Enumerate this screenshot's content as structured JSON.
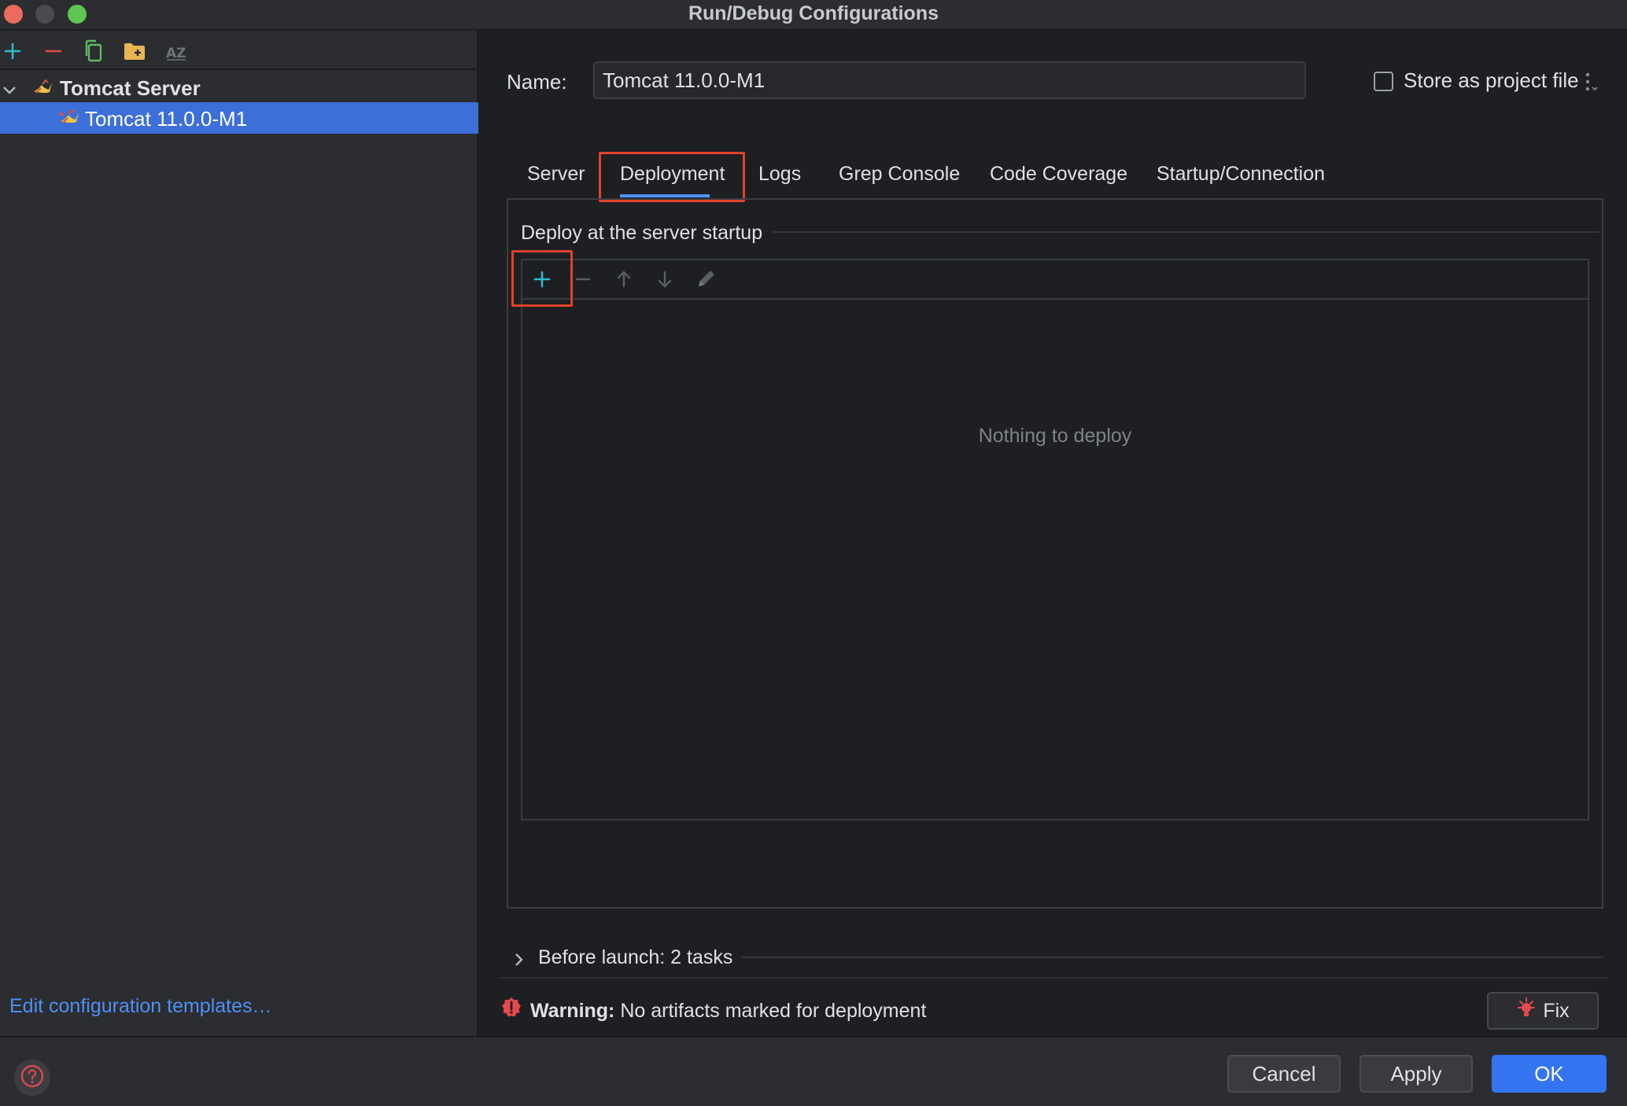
{
  "window": {
    "title": "Run/Debug Configurations"
  },
  "sidebar": {
    "toolbar": [
      "add-icon",
      "remove-icon",
      "copy-icon",
      "new-folder-icon",
      "sort-az-icon"
    ],
    "group_label": "Tomcat Server",
    "item_label": "Tomcat 11.0.0-M1",
    "edit_templates": "Edit configuration templates…"
  },
  "form": {
    "name_label": "Name:",
    "name_value": "Tomcat 11.0.0-M1",
    "store_label": "Store as project file",
    "store_checked": false
  },
  "tabs": [
    {
      "label": "Server"
    },
    {
      "label": "Deployment",
      "active": true
    },
    {
      "label": "Logs"
    },
    {
      "label": "Grep Console"
    },
    {
      "label": "Code Coverage"
    },
    {
      "label": "Startup/Connection"
    }
  ],
  "deployment": {
    "section_title": "Deploy at the server startup",
    "toolbar": [
      "add-icon",
      "remove-icon",
      "move-up-icon",
      "move-down-icon",
      "edit-icon"
    ],
    "empty_text": "Nothing to deploy"
  },
  "before_launch": {
    "label": "Before launch: 2 tasks"
  },
  "warning": {
    "prefix": "Warning:",
    "message": " No artifacts marked for deployment",
    "fix_label": "Fix"
  },
  "buttons": {
    "cancel": "Cancel",
    "apply": "Apply",
    "ok": "OK"
  },
  "colors": {
    "accent": "#3574f0",
    "selection": "#3d6fd8",
    "highlight_box": "#e5412d",
    "warning_red": "#e5484d"
  }
}
